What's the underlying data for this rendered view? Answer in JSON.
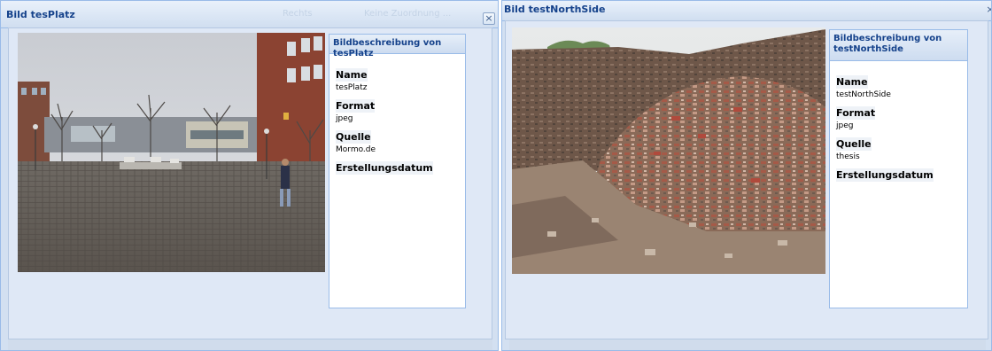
{
  "windows": [
    {
      "title": "Bild tesPlatz",
      "close_glyph": "×",
      "faint_tabs": [
        "Rechts",
        "Keine Zuordnung ..."
      ],
      "panel": {
        "header": "Bildbeschreibung von tesPlatz",
        "fields": [
          {
            "label": "Name",
            "value": "tesPlatz"
          },
          {
            "label": "Format",
            "value": "jpeg"
          },
          {
            "label": "Quelle",
            "value": "Mormo.de"
          },
          {
            "label": "Erstellungsdatum",
            "value": ""
          }
        ]
      },
      "image": {
        "subject": "town square with brick pavement, trees and buildings"
      }
    },
    {
      "title": "Bild testNorthSide",
      "close_glyph": "×",
      "panel": {
        "header": "Bildbeschreibung von testNorthSide",
        "fields": [
          {
            "label": "Name",
            "value": "testNorthSide"
          },
          {
            "label": "Format",
            "value": "jpeg"
          },
          {
            "label": "Quelle",
            "value": "thesis"
          },
          {
            "label": "Erstellungsdatum",
            "value": ""
          }
        ]
      },
      "image": {
        "subject": "rubble pile of brick and earth"
      }
    }
  ],
  "colors": {
    "title": "#15428b",
    "frame": "#d3e0f1",
    "border": "#99bbe8"
  }
}
